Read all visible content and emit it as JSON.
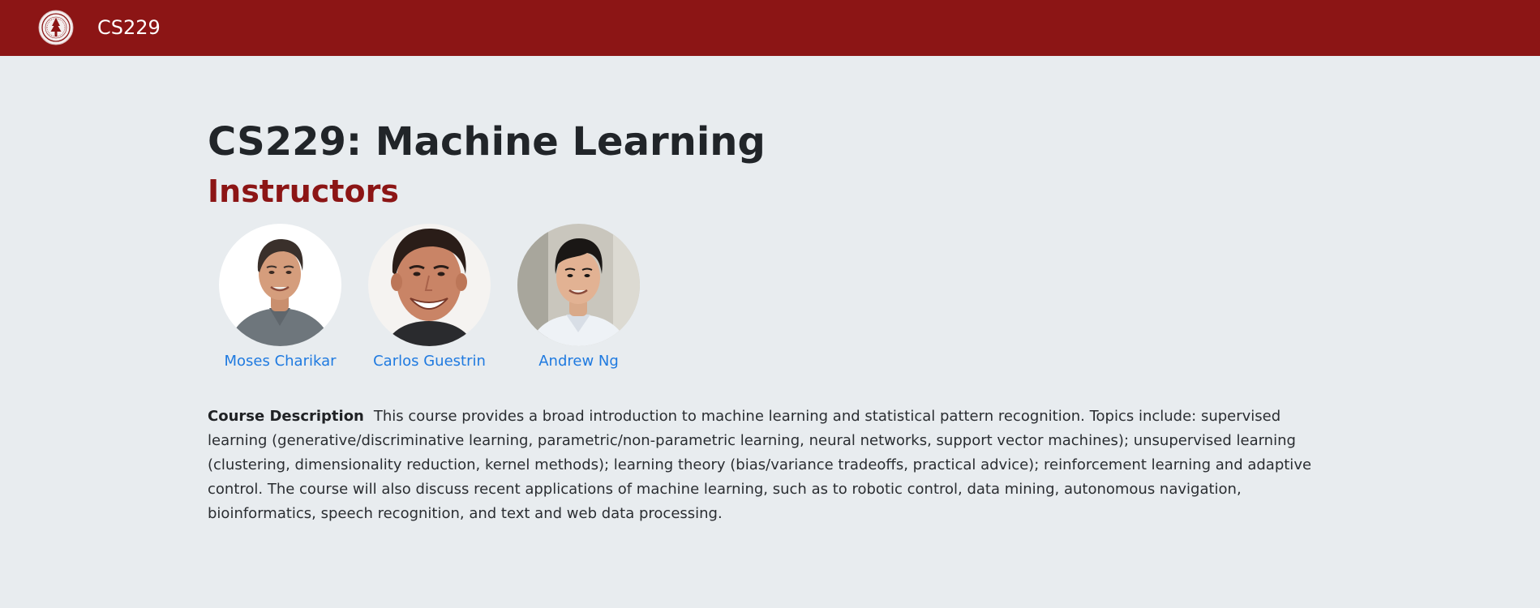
{
  "header": {
    "brand": "CS229",
    "logo_icon": "stanford-seal-icon",
    "bar_color": "#8c1515"
  },
  "main": {
    "title": "CS229: Machine Learning",
    "instructors_heading": "Instructors",
    "instructors": [
      {
        "name": "Moses Charikar",
        "photo": "instructor-photo"
      },
      {
        "name": "Carlos Guestrin",
        "photo": "instructor-photo"
      },
      {
        "name": "Andrew Ng",
        "photo": "instructor-photo"
      }
    ],
    "description": {
      "label": "Course Description",
      "text": "This course provides a broad introduction to machine learning and statistical pattern recognition. Topics include: supervised learning (generative/discriminative learning, parametric/non-parametric learning, neural networks, support vector machines); unsupervised learning (clustering, dimensionality reduction, kernel methods); learning theory (bias/variance tradeoffs, practical advice); reinforcement learning and adaptive control. The course will also discuss recent applications of machine learning, such as to robotic control, data mining, autonomous navigation, bioinformatics, speech recognition, and text and web data processing."
    }
  },
  "colors": {
    "accent": "#8c1515",
    "link": "#1f7ae0",
    "background": "#e8ecef"
  }
}
